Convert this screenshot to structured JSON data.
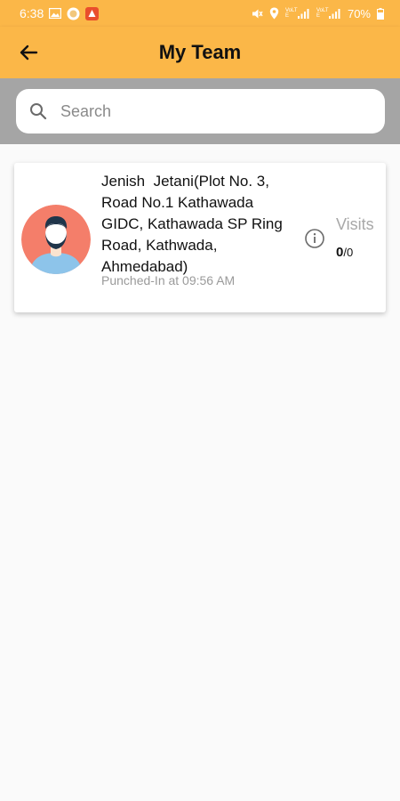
{
  "status_bar": {
    "time": "6:38",
    "battery": "70%",
    "network_label_1": "VoLTE",
    "network_label_2": "VoLTE"
  },
  "app_bar": {
    "title": "My Team"
  },
  "search": {
    "placeholder": "Search"
  },
  "team": [
    {
      "name": "Jenish  Jetani(Plot No. 3, Road No.1 Kathawada GIDC, Kathawada SP Ring Road, Kathwada, Ahmedabad)",
      "punch_status": "Punched-In at 09:56 AM",
      "visits_label": "Visits",
      "visits_done": "0",
      "visits_separator": "/",
      "visits_total": "0"
    }
  ],
  "colors": {
    "accent": "#fbb748",
    "search_band": "#a5a5a5",
    "avatar_bg": "#f47e6a"
  }
}
